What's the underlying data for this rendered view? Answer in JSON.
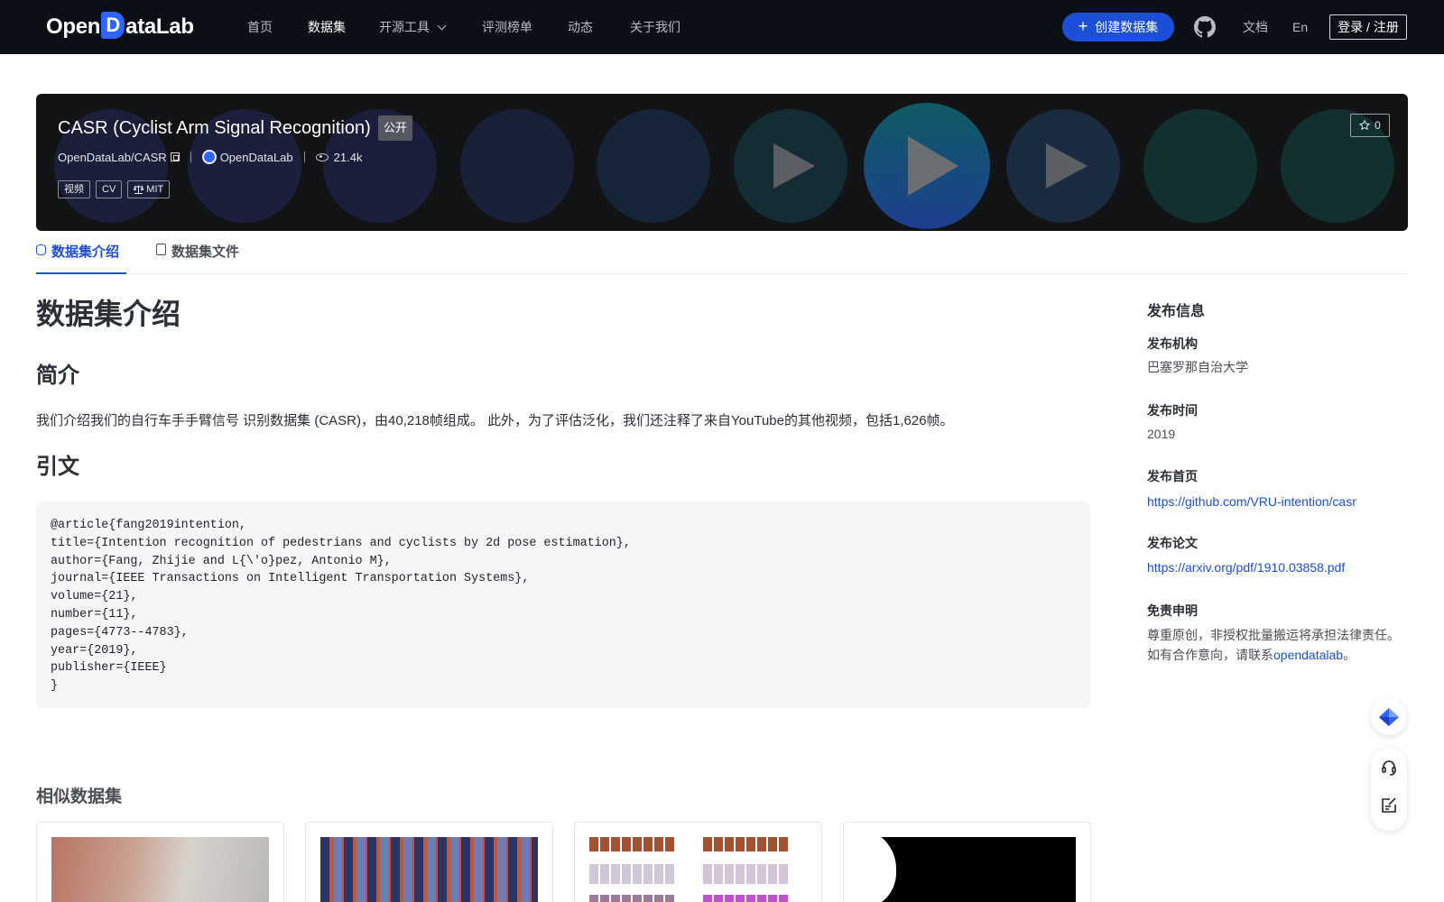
{
  "header": {
    "logo_text_left": "Open",
    "logo_text_mid": "D",
    "logo_text_right": "ataLab",
    "nav": [
      {
        "label": "首页"
      },
      {
        "label": "数据集"
      },
      {
        "label": "开源工具"
      },
      {
        "label": "评测榜单"
      },
      {
        "label": "动态"
      },
      {
        "label": "关于我们"
      }
    ],
    "create_label": "创建数据集",
    "docs_label": "文档",
    "lang_label": "En",
    "login_label": "登录 / 注册"
  },
  "dataset": {
    "title": "CASR (Cyclist Arm Signal Recognition)",
    "visibility": "公开",
    "repo": "OpenDataLab/CASR",
    "org": "OpenDataLab",
    "views": "21.4k",
    "tags": [
      "视频",
      "CV",
      "MIT"
    ],
    "stars": "0"
  },
  "tabs": [
    {
      "label": "数据集介绍"
    },
    {
      "label": "数据集文件"
    }
  ],
  "content": {
    "heading": "数据集介绍",
    "intro_heading": "简介",
    "intro_text": "我们介绍我们的自行车手手臂信号 识别数据集 (CASR)，由40,218帧组成。 此外，为了评估泛化，我们还注释了来自YouTube的其他视频，包括1,626帧。",
    "citation_heading": "引文",
    "citation_code": "@article{fang2019intention,\ntitle={Intention recognition of pedestrians and cyclists by 2d pose estimation},\nauthor={Fang, Zhijie and L{\\'o}pez, Antonio M},\njournal={IEEE Transactions on Intelligent Transportation Systems},\nvolume={21},\nnumber={11},\npages={4773--4783},\nyear={2019},\npublisher={IEEE}\n}",
    "similar_heading": "相似数据集"
  },
  "sidebar": {
    "title": "发布信息",
    "org_label": "发布机构",
    "org_value": "巴塞罗那自治大学",
    "time_label": "发布时间",
    "time_value": "2019",
    "home_label": "发布首页",
    "home_url": "https://github.com/VRU-intention/casr",
    "paper_label": "发布论文",
    "paper_url": "https://arxiv.org/pdf/1910.03858.pdf",
    "disclaimer_label": "免责申明",
    "disclaimer_line1": "尊重原创，非授权批量搬运将承担法律责任。",
    "disclaimer_line2_prefix": "如有合作意向，请联系",
    "disclaimer_link": "opendatalab",
    "disclaimer_line2_suffix": "。"
  },
  "colors": {
    "nav_bg": "#0b1017",
    "accent": "#1d4ed8",
    "banner_bg": "#111315"
  }
}
